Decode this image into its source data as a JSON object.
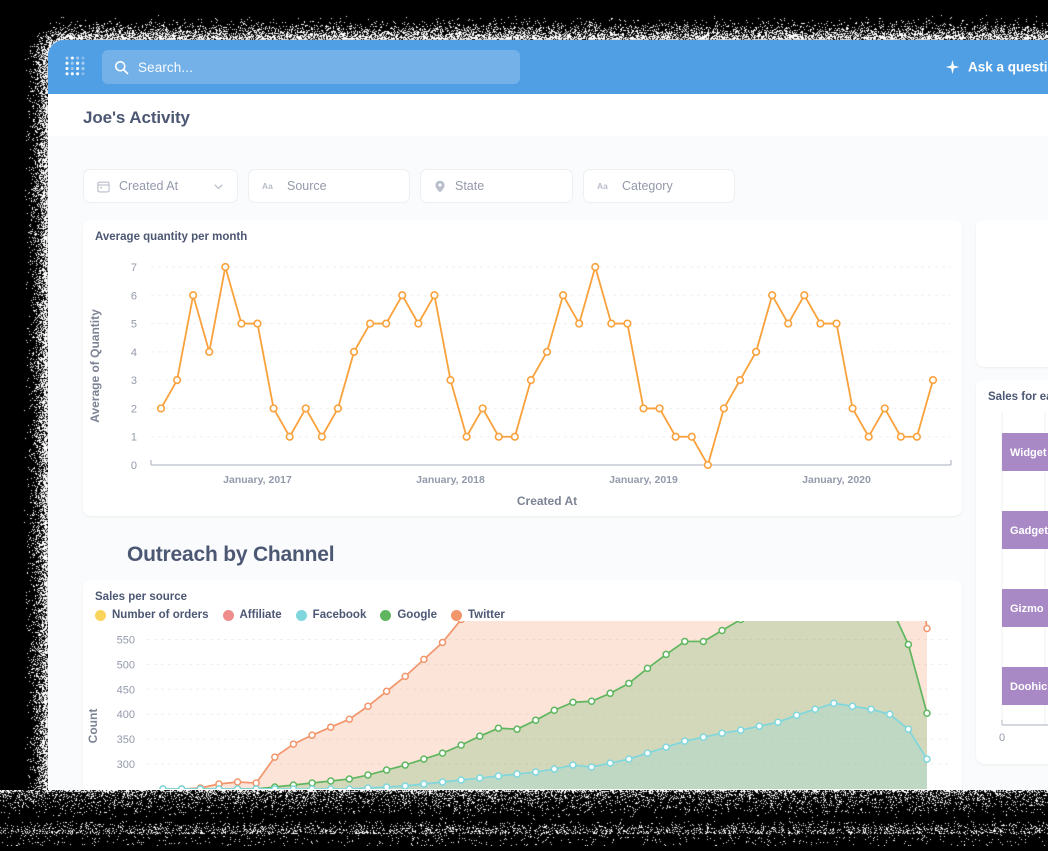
{
  "colors": {
    "brand_blue": "#509EE3",
    "text_dark": "#4C5773",
    "text_muted": "#949AAB",
    "page_bg": "#F9FBFC",
    "line_orange": "#F9A13B",
    "bar_purple": "#A989C5",
    "series_orders": "#F9D45C",
    "series_affiliate": "#EF8C8C",
    "series_facebook": "#7FD7DD",
    "series_google": "#5FB65F",
    "series_twitter": "#F2956B"
  },
  "topnav": {
    "logo_icon": "metabase-logo-icon",
    "search_icon": "search-icon",
    "search_placeholder": "Search...",
    "ask_icon": "sparkle-icon",
    "ask_label": "Ask a question"
  },
  "header": {
    "dashboard_title": "Joe's Activity"
  },
  "filters": [
    {
      "label": "Created At",
      "icon": "calendar-icon",
      "has_caret": true
    },
    {
      "label": "Source",
      "icon": "text-aa-icon",
      "has_caret": false
    },
    {
      "label": "State",
      "icon": "location-pin-icon",
      "has_caret": false
    },
    {
      "label": "Category",
      "icon": "text-aa-icon",
      "has_caret": false
    }
  ],
  "section": {
    "outreach_heading": "Outreach by Channel"
  },
  "cards": {
    "line_card_title": "Average quantity per month",
    "area_card_title": "Sales per source",
    "bar_card_title": "Sales for each",
    "blank_card_text": "|"
  },
  "chart_data": [
    {
      "type": "line",
      "title": "Average quantity per month",
      "xlabel": "Created At",
      "ylabel": "Average of Quantity",
      "ylim": [
        0,
        7
      ],
      "yticks": [
        0,
        1,
        2,
        3,
        4,
        5,
        6,
        7
      ],
      "xticks": [
        "January, 2017",
        "January, 2018",
        "January, 2019",
        "January, 2020"
      ],
      "xtick_positions": [
        6,
        18,
        30,
        42
      ],
      "grid": true,
      "legend": "none",
      "color": "#F9A13B",
      "values": [
        2,
        3,
        6,
        4,
        7,
        5,
        5,
        2,
        1,
        2,
        1,
        2,
        4,
        5,
        5,
        6,
        5,
        6,
        3,
        1,
        2,
        1,
        1,
        3,
        4,
        6,
        5,
        7,
        5,
        5,
        2,
        2,
        1,
        1,
        0,
        2,
        3,
        4,
        6,
        5,
        6,
        5,
        5,
        2,
        1,
        2,
        1,
        1,
        3
      ]
    },
    {
      "type": "area",
      "stacked": true,
      "title": "Sales per source",
      "xlabel": "",
      "ylabel": "Count",
      "ylim": [
        250,
        575
      ],
      "yticks": [
        300,
        350,
        400,
        450,
        500,
        550
      ],
      "grid": true,
      "legend": "top",
      "series": [
        {
          "name": "Number of orders",
          "color": "#F9D45C",
          "values": []
        },
        {
          "name": "Affiliate",
          "color": "#EF8C8C",
          "values": []
        },
        {
          "name": "Facebook",
          "color": "#7FD7DD",
          "values": [
            0,
            0,
            0,
            0,
            0,
            0,
            0,
            0,
            0,
            0,
            0,
            2,
            4,
            6,
            10,
            14,
            18,
            22,
            26,
            30,
            34,
            40,
            48,
            44,
            52,
            60,
            72,
            84,
            96,
            104,
            112,
            118,
            126,
            134,
            148,
            160,
            172,
            166,
            160,
            150,
            120,
            60
          ]
        },
        {
          "name": "Google",
          "color": "#5FB65F",
          "values": [
            0,
            0,
            0,
            0,
            0,
            0,
            4,
            8,
            12,
            16,
            20,
            26,
            34,
            42,
            50,
            58,
            70,
            84,
            96,
            90,
            104,
            118,
            126,
            132,
            140,
            152,
            170,
            186,
            200,
            192,
            206,
            222,
            238,
            226,
            244,
            258,
            250,
            242,
            234,
            220,
            170,
            92
          ]
        },
        {
          "name": "Twitter",
          "color": "#F2956B",
          "values": [
            0,
            0,
            2,
            10,
            14,
            12,
            60,
            82,
            96,
            108,
            120,
            138,
            158,
            178,
            200,
            222,
            252,
            276,
            250,
            268,
            288,
            296,
            310,
            336,
            358,
            330,
            352,
            372,
            386,
            398,
            380,
            396,
            410,
            420,
            412,
            424,
            430,
            418,
            406,
            394,
            340,
            170
          ]
        }
      ]
    },
    {
      "type": "bar",
      "orientation": "horizontal",
      "title": "Sales for each",
      "categories": [
        "Widget",
        "Gadget",
        "Gizmo",
        "Doohickey"
      ],
      "values": [
        100,
        100,
        100,
        100
      ],
      "color": "#A989C5",
      "xticks": [
        "0"
      ],
      "grid": true,
      "legend": "none"
    }
  ]
}
